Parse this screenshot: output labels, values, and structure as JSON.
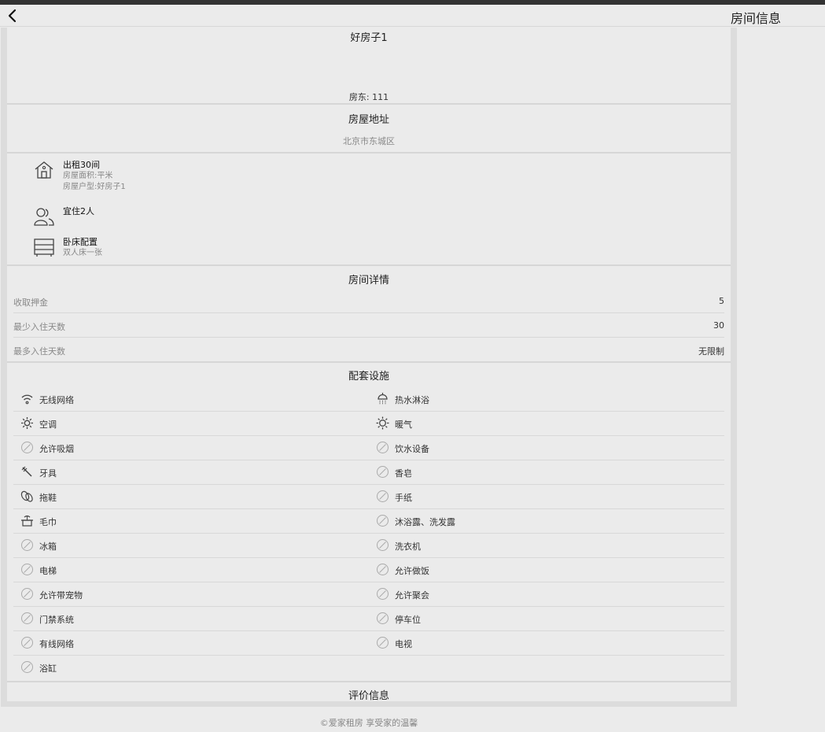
{
  "nav": {
    "title": "房间信息"
  },
  "house": {
    "name": "好房子1",
    "landlord": "房东:  111"
  },
  "address": {
    "title": "房屋地址",
    "value": "北京市东城区"
  },
  "features": [
    {
      "icon": "house-icon",
      "title": "出租30间",
      "subs": [
        "房屋面积:平米",
        "房屋户型:好房子1"
      ]
    },
    {
      "icon": "people-icon",
      "title": "宜住2人",
      "subs": []
    },
    {
      "icon": "bed-icon",
      "title": "卧床配置",
      "subs": [
        "双人床一张"
      ]
    }
  ],
  "details": {
    "title": "房间详情",
    "rows": [
      {
        "label": "收取押金",
        "value": "5"
      },
      {
        "label": "最少入住天数",
        "value": "30"
      },
      {
        "label": "最多入住天数",
        "value": "无限制"
      }
    ]
  },
  "facilities": {
    "title": "配套设施",
    "items": [
      {
        "label": "无线网络",
        "icon": "wifi-icon",
        "available": true
      },
      {
        "label": "热水淋浴",
        "icon": "shower-icon",
        "available": true
      },
      {
        "label": "空调",
        "icon": "air-conditioner-icon",
        "available": true
      },
      {
        "label": "暖气",
        "icon": "heater-icon",
        "available": true
      },
      {
        "label": "允许吸烟",
        "icon": "unavailable-icon",
        "available": false
      },
      {
        "label": "饮水设备",
        "icon": "unavailable-icon",
        "available": false
      },
      {
        "label": "牙具",
        "icon": "toothbrush-icon",
        "available": true
      },
      {
        "label": "香皂",
        "icon": "unavailable-icon",
        "available": false
      },
      {
        "label": "拖鞋",
        "icon": "slippers-icon",
        "available": true
      },
      {
        "label": "手纸",
        "icon": "unavailable-icon",
        "available": false
      },
      {
        "label": "毛巾",
        "icon": "towel-icon",
        "available": true
      },
      {
        "label": "沐浴露、洗发露",
        "icon": "unavailable-icon",
        "available": false
      },
      {
        "label": "冰箱",
        "icon": "unavailable-icon",
        "available": false
      },
      {
        "label": "洗衣机",
        "icon": "unavailable-icon",
        "available": false
      },
      {
        "label": "电梯",
        "icon": "unavailable-icon",
        "available": false
      },
      {
        "label": "允许做饭",
        "icon": "unavailable-icon",
        "available": false
      },
      {
        "label": "允许带宠物",
        "icon": "unavailable-icon",
        "available": false
      },
      {
        "label": "允许聚会",
        "icon": "unavailable-icon",
        "available": false
      },
      {
        "label": "门禁系统",
        "icon": "unavailable-icon",
        "available": false
      },
      {
        "label": "停车位",
        "icon": "unavailable-icon",
        "available": false
      },
      {
        "label": "有线网络",
        "icon": "unavailable-icon",
        "available": false
      },
      {
        "label": "电视",
        "icon": "unavailable-icon",
        "available": false
      },
      {
        "label": "浴缸",
        "icon": "unavailable-icon",
        "available": false
      }
    ]
  },
  "reviews": {
    "title": "评价信息"
  },
  "footer": {
    "text": "©爱家租房  享受家的温馨"
  }
}
